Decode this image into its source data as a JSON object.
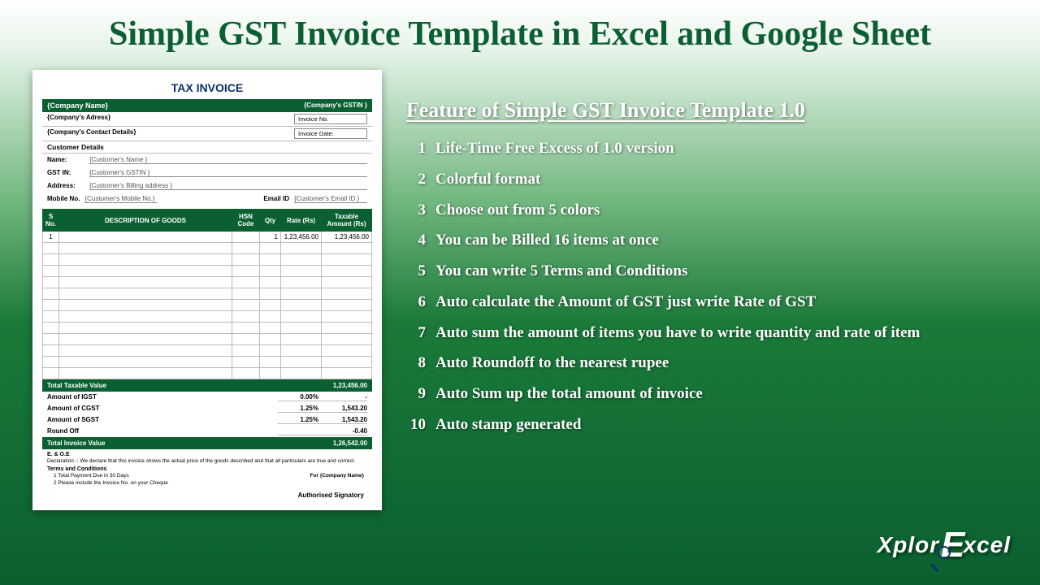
{
  "title": "Simple GST Invoice Template in Excel and Google Sheet",
  "feature_heading": "Feature of Simple GST Invoice Template 1.0",
  "features": [
    "Life-Time Free Excess of 1.0 version",
    "Colorful format",
    "Choose out from 5 colors",
    "You can be Billed 16 items at once",
    "You can write 5 Terms and Conditions",
    "Auto calculate the Amount of GST just write Rate of GST",
    "Auto sum the amount of items you have to write quantity and rate of item",
    "Auto Roundoff to the nearest rupee",
    "Auto Sum up the total amount of invoice",
    "Auto stamp generated"
  ],
  "invoice": {
    "title": "TAX INVOICE",
    "company_name": "{Company Name}",
    "company_gstin": "{Company's GSTIN }",
    "company_address": "{Company's Adress}",
    "company_contact": "{Company's Contact Details}",
    "inv_no_lbl": "Invoice No.",
    "inv_date_lbl": "Invoice Date:",
    "cust_det": "Customer Details",
    "name_lbl": "Name:",
    "name_val": "{Customer's Name }",
    "gstin_lbl": "GST IN:",
    "gstin_val": "{Customer's GSTIN }",
    "addr_lbl": "Address:",
    "addr_val": "{Customer's Billing address }",
    "mobile_lbl": "Mobile No.",
    "mobile_val": "{Customer's Mobile No.}",
    "email_lbl": "Email ID",
    "email_val": "{Customer's Email ID }",
    "headers": {
      "sno": "S No.",
      "desc": "DESCRIPTION OF GOODS",
      "hsn": "HSN Code",
      "qty": "Qty",
      "rate": "Rate (Rs)",
      "amount": "Taxable Amount (Rs)"
    },
    "row1": {
      "sno": "1",
      "qty": "1",
      "rate": "1,23,456.00",
      "amount": "1,23,456.00"
    },
    "total_taxable_lbl": "Total Taxable Value",
    "total_taxable_val": "1,23,456.00",
    "igst_lbl": "Amount of IGST",
    "igst_pct": "0.00%",
    "igst_val": "-",
    "cgst_lbl": "Amount of CGST",
    "cgst_pct": "1.25%",
    "cgst_val": "1,543.20",
    "sgst_lbl": "Amount of SGST",
    "sgst_pct": "1.25%",
    "sgst_val": "1,543.20",
    "round_lbl": "Round Off",
    "round_val": "-0.40",
    "total_inv_lbl": "Total Invoice Value",
    "total_inv_val": "1,26,542.00",
    "eoe": "E. & O.E",
    "decl": "Declaration -: We declare that this invoice shows the actual price of the goods described and that all particulars are true and correct.",
    "terms_lbl": "Terms and Conditions",
    "term1": "1  Total Payment Due in 30 Days",
    "term2": "2  Please include the Invoice No. on your Cheque",
    "for_company": "For {Company Name}",
    "signatory": "Authorised Signatory"
  },
  "logo": {
    "p1": "Xplor",
    "e": "E",
    "p2": "xcel"
  }
}
